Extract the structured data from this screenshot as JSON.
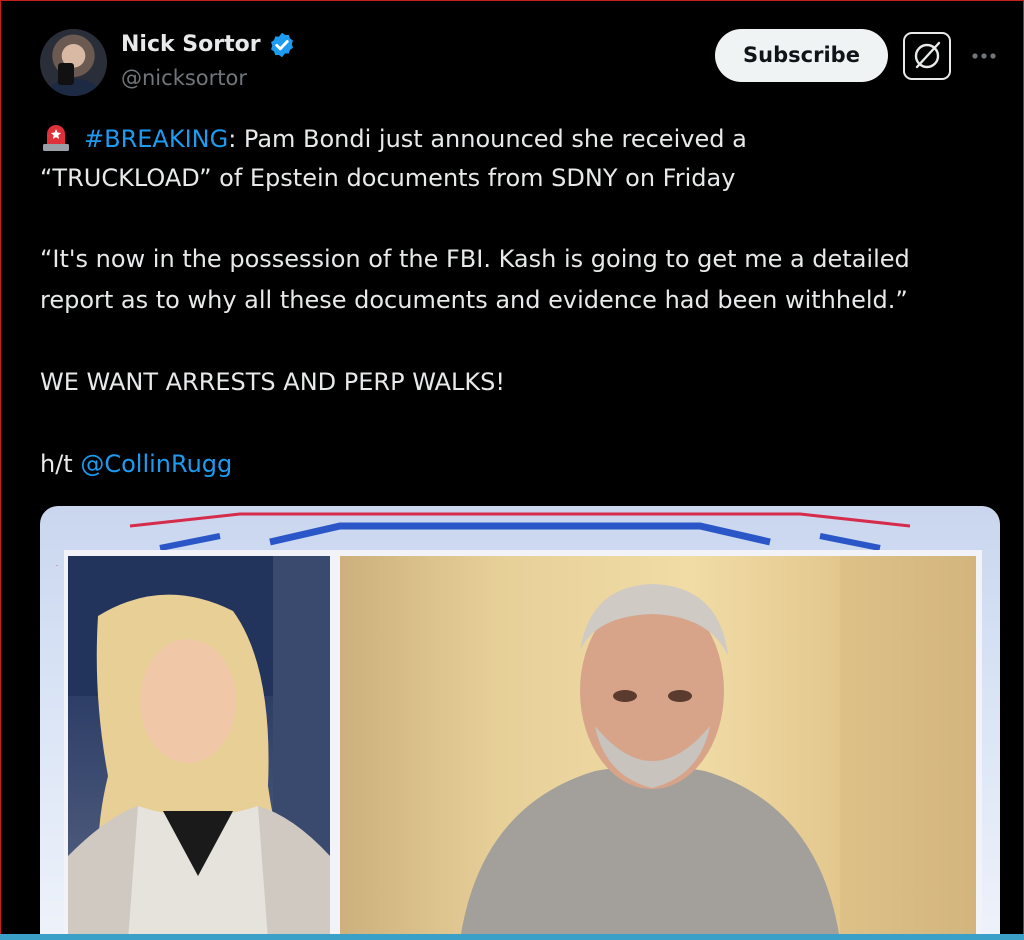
{
  "author": {
    "name": "Nick Sortor",
    "handle": "@nicksortor",
    "verified": true
  },
  "actions": {
    "subscribe_label": "Subscribe"
  },
  "icons": {
    "verified": "verified-badge-icon",
    "grok": "grok-icon",
    "more": "more-options-icon",
    "siren": "police-light-emoji"
  },
  "post": {
    "line1_hashtag": "#BREAKING",
    "line1_text": ": Pam Bondi just announced she received a",
    "line2": "“TRUCKLOAD” of Epstein documents from SDNY on Friday",
    "quote_line1": "“It's now in the possession of the FBI. Kash is going to get me a detailed",
    "quote_line2": "report as to why all these documents and evidence had been withheld.”",
    "line_caps": "WE WANT ARRESTS AND PERP WALKS!",
    "ht_prefix": "h/t ",
    "ht_mention": "@CollinRugg"
  },
  "colors": {
    "background": "#000000",
    "text": "#e7e9ea",
    "muted": "#71767b",
    "link": "#1d9bf0",
    "verified": "#1d9bf0"
  }
}
